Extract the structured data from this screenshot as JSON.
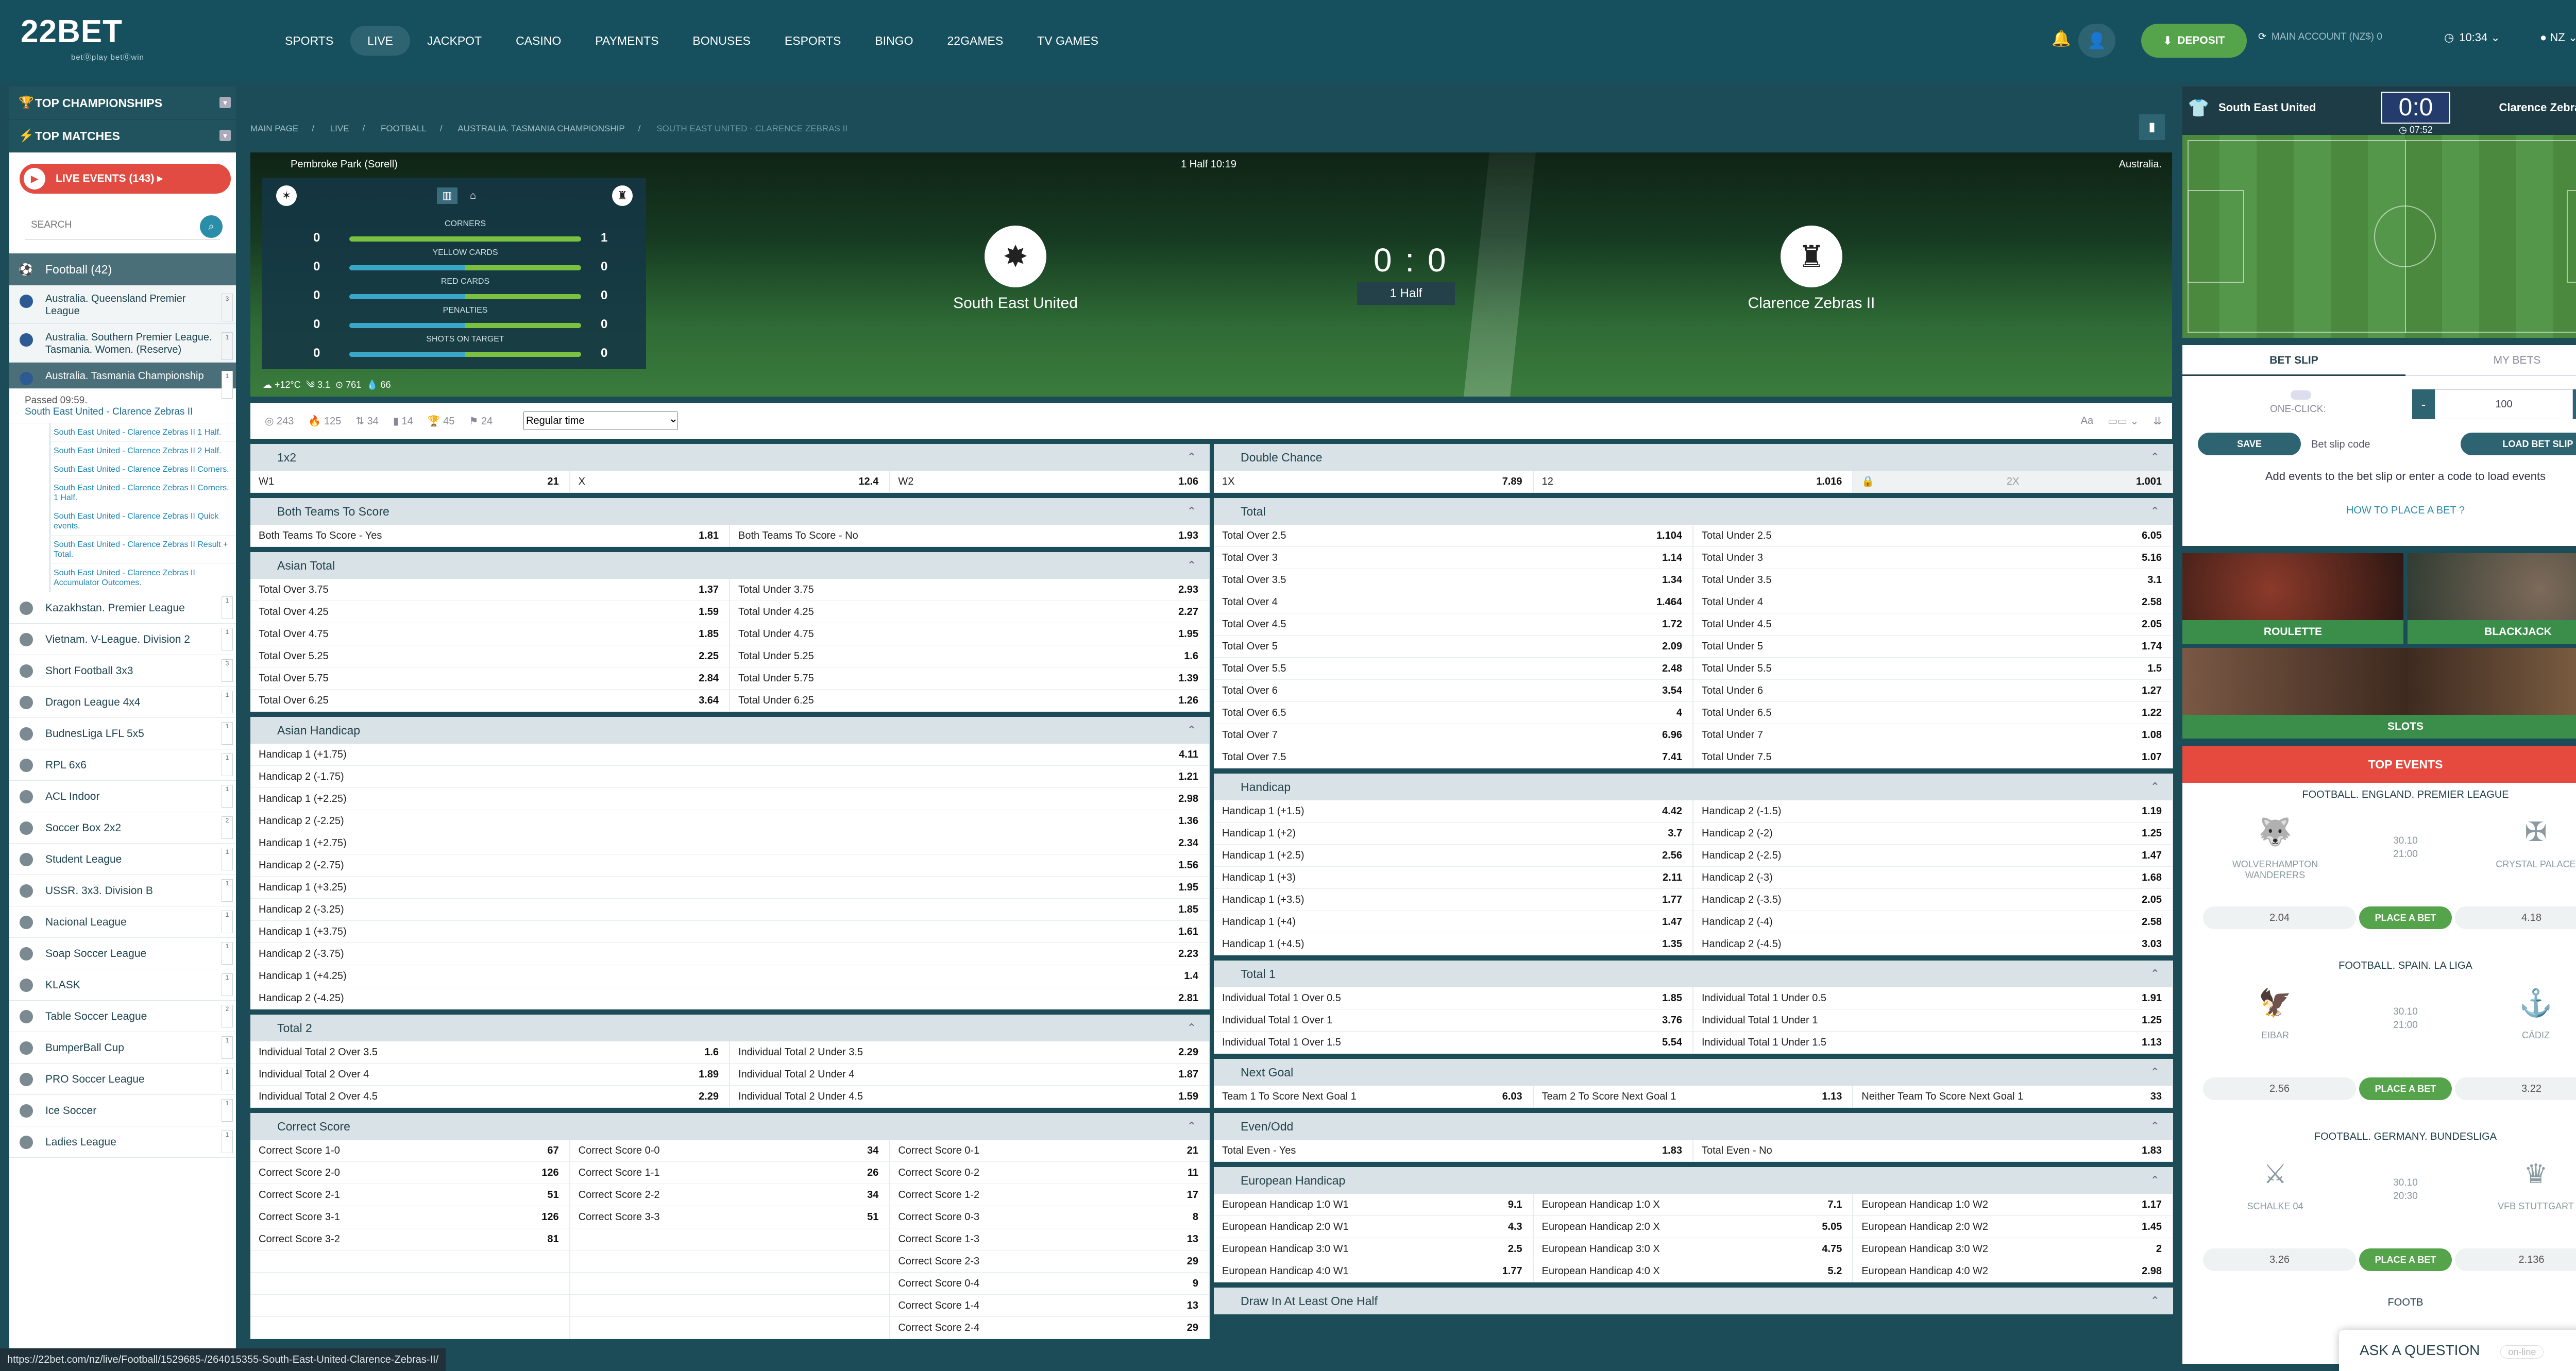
{
  "brand": {
    "logo": "22BET",
    "tagline": "bet⓪play bet⓪win"
  },
  "nav": [
    "SPORTS",
    "LIVE",
    "JACKPOT",
    "CASINO",
    "PAYMENTS",
    "BONUSES",
    "ESPORTS",
    "BINGO",
    "22GAMES",
    "TV GAMES"
  ],
  "header": {
    "deposit": "DEPOSIT",
    "account": "MAIN ACCOUNT (NZ$) 0",
    "time": "10:34",
    "lang": "NZ"
  },
  "sidebar": {
    "top_championships": "TOP CHAMPIONSHIPS",
    "top_matches": "TOP MATCHES",
    "live_events": "LIVE EVENTS (143)",
    "search_placeholder": "SEARCH",
    "sport": "Football (42)",
    "leagues_top": [
      {
        "name": "Australia. Queensland Premier League",
        "count": "3"
      },
      {
        "name": "Australia. Southern Premier League. Tasmania. Women. (Reserve)",
        "count": "1"
      },
      {
        "name": "Australia. Tasmania Championship",
        "count": "1"
      }
    ],
    "match": {
      "passed": "Passed 09:59.",
      "title": "South East United - Clarence Zebras II"
    },
    "sub_events": [
      "South East United - Clarence Zebras II 1 Half.",
      "South East United - Clarence Zebras II 2 Half.",
      "South East United - Clarence Zebras II Corners.",
      "South East United - Clarence Zebras II Corners. 1 Half.",
      "South East United - Clarence Zebras II Quick events.",
      "South East United - Clarence Zebras II Result + Total.",
      "South East United - Clarence Zebras II Accumulator Outcomes."
    ],
    "leagues": [
      {
        "name": "Kazakhstan. Premier League",
        "count": "1"
      },
      {
        "name": "Vietnam. V-League. Division 2",
        "count": "1"
      },
      {
        "name": "Short Football 3x3",
        "count": "3"
      },
      {
        "name": "Dragon League 4x4",
        "count": "1"
      },
      {
        "name": "BudnesLiga LFL 5x5",
        "count": "1"
      },
      {
        "name": "RPL 6x6",
        "count": "1"
      },
      {
        "name": "ACL Indoor",
        "count": "1"
      },
      {
        "name": "Soccer Box 2x2",
        "count": "2"
      },
      {
        "name": "Student League",
        "count": "1"
      },
      {
        "name": "USSR. 3x3. Division B",
        "count": "1"
      },
      {
        "name": "Nacional League",
        "count": "1"
      },
      {
        "name": "Soap Soccer League",
        "count": "1"
      },
      {
        "name": "KLASK",
        "count": "1"
      },
      {
        "name": "Table Soccer League",
        "count": "2"
      },
      {
        "name": "BumperBall Cup",
        "count": "1"
      },
      {
        "name": "PRO Soccer League",
        "count": "1"
      },
      {
        "name": "Ice Soccer",
        "count": "1"
      },
      {
        "name": "Ladies League",
        "count": "1"
      }
    ]
  },
  "breadcrumbs": [
    "MAIN PAGE",
    "LIVE",
    "FOOTBALL",
    "AUSTRALIA. TASMANIA CHAMPIONSHIP",
    "SOUTH EAST UNITED - CLARENCE ZEBRAS II"
  ],
  "match": {
    "venue": "Pembroke Park (Sorell)",
    "period": "1 Half 10:19",
    "country": "Australia.",
    "home": "South East United",
    "away": "Clarence Zebras II",
    "score": "0 : 0",
    "half": "1 Half",
    "stats": [
      {
        "label": "CORNERS",
        "home": "0",
        "away": "1",
        "home_share": 0
      },
      {
        "label": "YELLOW CARDS",
        "home": "0",
        "away": "0",
        "home_share": 0.5
      },
      {
        "label": "RED CARDS",
        "home": "0",
        "away": "0",
        "home_share": 0.5
      },
      {
        "label": "PENALTIES",
        "home": "0",
        "away": "0",
        "home_share": 0.5
      },
      {
        "label": "SHOTS ON TARGET",
        "home": "0",
        "away": "0",
        "home_share": 0.5
      }
    ],
    "weather": {
      "temp": "+12°C",
      "wind": "3.1",
      "pressure": "761",
      "humidity": "66"
    }
  },
  "filters": {
    "counts": [
      "243",
      "125",
      "34",
      "14",
      "45",
      "24"
    ],
    "period": "Regular time"
  },
  "markets_left": [
    {
      "title": "1x2",
      "rows": [
        [
          [
            "W1",
            "21"
          ],
          [
            "X",
            "12.4"
          ],
          [
            "W2",
            "1.06"
          ]
        ]
      ]
    },
    {
      "title": "Both Teams To Score",
      "rows": [
        [
          [
            "Both Teams To Score - Yes",
            "1.81"
          ],
          [
            "Both Teams To Score - No",
            "1.93"
          ]
        ]
      ]
    },
    {
      "title": "Asian Total",
      "rows": [
        [
          [
            "Total Over 3.75",
            "1.37"
          ],
          [
            "Total Under 3.75",
            "2.93"
          ]
        ],
        [
          [
            "Total Over 4.25",
            "1.59"
          ],
          [
            "Total Under 4.25",
            "2.27"
          ]
        ],
        [
          [
            "Total Over 4.75",
            "1.85"
          ],
          [
            "Total Under 4.75",
            "1.95"
          ]
        ],
        [
          [
            "Total Over 5.25",
            "2.25"
          ],
          [
            "Total Under 5.25",
            "1.6"
          ]
        ],
        [
          [
            "Total Over 5.75",
            "2.84"
          ],
          [
            "Total Under 5.75",
            "1.39"
          ]
        ],
        [
          [
            "Total Over 6.25",
            "3.64"
          ],
          [
            "Total Under 6.25",
            "1.26"
          ]
        ]
      ]
    },
    {
      "title": "Asian Handicap",
      "rows": [
        [
          [
            "Handicap 1 (+1.75)",
            "4.11"
          ]
        ],
        [
          [
            "Handicap 2 (-1.75)",
            "1.21"
          ]
        ],
        [
          [
            "Handicap 1 (+2.25)",
            "2.98"
          ]
        ],
        [
          [
            "Handicap 2 (-2.25)",
            "1.36"
          ]
        ],
        [
          [
            "Handicap 1 (+2.75)",
            "2.34"
          ]
        ],
        [
          [
            "Handicap 2 (-2.75)",
            "1.56"
          ]
        ],
        [
          [
            "Handicap 1 (+3.25)",
            "1.95"
          ]
        ],
        [
          [
            "Handicap 2 (-3.25)",
            "1.85"
          ]
        ],
        [
          [
            "Handicap 1 (+3.75)",
            "1.61"
          ]
        ],
        [
          [
            "Handicap 2 (-3.75)",
            "2.23"
          ]
        ],
        [
          [
            "Handicap 1 (+4.25)",
            "1.4"
          ]
        ],
        [
          [
            "Handicap 2 (-4.25)",
            "2.81"
          ]
        ]
      ]
    },
    {
      "title": "Total 2",
      "rows": [
        [
          [
            "Individual Total 2 Over 3.5",
            "1.6"
          ],
          [
            "Individual Total 2 Under 3.5",
            "2.29"
          ]
        ],
        [
          [
            "Individual Total 2 Over 4",
            "1.89"
          ],
          [
            "Individual Total 2 Under 4",
            "1.87"
          ]
        ],
        [
          [
            "Individual Total 2 Over 4.5",
            "2.29"
          ],
          [
            "Individual Total 2 Under 4.5",
            "1.59"
          ]
        ]
      ]
    },
    {
      "title": "Correct Score",
      "rows": [
        [
          [
            "Correct Score 1-0",
            "67"
          ],
          [
            "Correct Score 0-0",
            "34"
          ],
          [
            "Correct Score 0-1",
            "21"
          ]
        ],
        [
          [
            "Correct Score 2-0",
            "126"
          ],
          [
            "Correct Score 1-1",
            "26"
          ],
          [
            "Correct Score 0-2",
            "11"
          ]
        ],
        [
          [
            "Correct Score 2-1",
            "51"
          ],
          [
            "Correct Score 2-2",
            "34"
          ],
          [
            "Correct Score 1-2",
            "17"
          ]
        ],
        [
          [
            "Correct Score 3-1",
            "126"
          ],
          [
            "Correct Score 3-3",
            "51"
          ],
          [
            "Correct Score 0-3",
            "8"
          ]
        ],
        [
          [
            "Correct Score 3-2",
            "81"
          ],
          [
            "",
            ""
          ],
          [
            "Correct Score 1-3",
            "13"
          ]
        ],
        [
          [
            "",
            ""
          ],
          [
            "",
            ""
          ],
          [
            "Correct Score 2-3",
            "29"
          ]
        ],
        [
          [
            "",
            ""
          ],
          [
            "",
            ""
          ],
          [
            "Correct Score 0-4",
            "9"
          ]
        ],
        [
          [
            "",
            ""
          ],
          [
            "",
            ""
          ],
          [
            "Correct Score 1-4",
            "13"
          ]
        ],
        [
          [
            "",
            ""
          ],
          [
            "",
            ""
          ],
          [
            "Correct Score 2-4",
            "29"
          ]
        ]
      ]
    }
  ],
  "markets_right": [
    {
      "title": "Double Chance",
      "rows": [
        [
          [
            "1X",
            "7.89"
          ],
          [
            "12",
            "1.016"
          ],
          [
            "2X",
            "1.001"
          ]
        ]
      ]
    },
    {
      "title": "Total",
      "rows": [
        [
          [
            "Total Over 2.5",
            "1.104"
          ],
          [
            "Total Under 2.5",
            "6.05"
          ]
        ],
        [
          [
            "Total Over 3",
            "1.14"
          ],
          [
            "Total Under 3",
            "5.16"
          ]
        ],
        [
          [
            "Total Over 3.5",
            "1.34"
          ],
          [
            "Total Under 3.5",
            "3.1"
          ]
        ],
        [
          [
            "Total Over 4",
            "1.464"
          ],
          [
            "Total Under 4",
            "2.58"
          ]
        ],
        [
          [
            "Total Over 4.5",
            "1.72"
          ],
          [
            "Total Under 4.5",
            "2.05"
          ]
        ],
        [
          [
            "Total Over 5",
            "2.09"
          ],
          [
            "Total Under 5",
            "1.74"
          ]
        ],
        [
          [
            "Total Over 5.5",
            "2.48"
          ],
          [
            "Total Under 5.5",
            "1.5"
          ]
        ],
        [
          [
            "Total Over 6",
            "3.54"
          ],
          [
            "Total Under 6",
            "1.27"
          ]
        ],
        [
          [
            "Total Over 6.5",
            "4"
          ],
          [
            "Total Under 6.5",
            "1.22"
          ]
        ],
        [
          [
            "Total Over 7",
            "6.96"
          ],
          [
            "Total Under 7",
            "1.08"
          ]
        ],
        [
          [
            "Total Over 7.5",
            "7.41"
          ],
          [
            "Total Under 7.5",
            "1.07"
          ]
        ]
      ]
    },
    {
      "title": "Handicap",
      "rows": [
        [
          [
            "Handicap 1 (+1.5)",
            "4.42"
          ],
          [
            "Handicap 2 (-1.5)",
            "1.19"
          ]
        ],
        [
          [
            "Handicap 1 (+2)",
            "3.7"
          ],
          [
            "Handicap 2 (-2)",
            "1.25"
          ]
        ],
        [
          [
            "Handicap 1 (+2.5)",
            "2.56"
          ],
          [
            "Handicap 2 (-2.5)",
            "1.47"
          ]
        ],
        [
          [
            "Handicap 1 (+3)",
            "2.11"
          ],
          [
            "Handicap 2 (-3)",
            "1.68"
          ]
        ],
        [
          [
            "Handicap 1 (+3.5)",
            "1.77"
          ],
          [
            "Handicap 2 (-3.5)",
            "2.05"
          ]
        ],
        [
          [
            "Handicap 1 (+4)",
            "1.47"
          ],
          [
            "Handicap 2 (-4)",
            "2.58"
          ]
        ],
        [
          [
            "Handicap 1 (+4.5)",
            "1.35"
          ],
          [
            "Handicap 2 (-4.5)",
            "3.03"
          ]
        ]
      ]
    },
    {
      "title": "Total 1",
      "rows": [
        [
          [
            "Individual Total 1 Over 0.5",
            "1.85"
          ],
          [
            "Individual Total 1 Under 0.5",
            "1.91"
          ]
        ],
        [
          [
            "Individual Total 1 Over 1",
            "3.76"
          ],
          [
            "Individual Total 1 Under 1",
            "1.25"
          ]
        ],
        [
          [
            "Individual Total 1 Over 1.5",
            "5.54"
          ],
          [
            "Individual Total 1 Under 1.5",
            "1.13"
          ]
        ]
      ]
    },
    {
      "title": "Next Goal",
      "rows": [
        [
          [
            "Team 1 To Score Next Goal 1",
            "6.03"
          ],
          [
            "Team 2 To Score Next Goal 1",
            "1.13"
          ],
          [
            "Neither Team To Score Next Goal 1",
            "33"
          ]
        ]
      ]
    },
    {
      "title": "Even/Odd",
      "rows": [
        [
          [
            "Total Even - Yes",
            "1.83"
          ],
          [
            "Total Even - No",
            "1.83"
          ]
        ]
      ]
    },
    {
      "title": "European Handicap",
      "rows": [
        [
          [
            "European Handicap 1:0 W1",
            "9.1"
          ],
          [
            "European Handicap 1:0 X",
            "7.1"
          ],
          [
            "European Handicap 1:0 W2",
            "1.17"
          ]
        ],
        [
          [
            "European Handicap 2:0 W1",
            "4.3"
          ],
          [
            "European Handicap 2:0 X",
            "5.05"
          ],
          [
            "European Handicap 2:0 W2",
            "1.45"
          ]
        ],
        [
          [
            "European Handicap 3:0 W1",
            "2.5"
          ],
          [
            "European Handicap 3:0 X",
            "4.75"
          ],
          [
            "European Handicap 3:0 W2",
            "2"
          ]
        ],
        [
          [
            "European Handicap 4:0 W1",
            "1.77"
          ],
          [
            "European Handicap 4:0 X",
            "5.2"
          ],
          [
            "European Handicap 4:0 W2",
            "2.98"
          ]
        ]
      ]
    },
    {
      "title": "Draw In At Least One Half",
      "rows": []
    }
  ],
  "scoreboard": {
    "home": "South East United",
    "away": "Clarence Zebras II",
    "score": "0:0",
    "clock": "07:52"
  },
  "betslip": {
    "tab1": "BET SLIP",
    "tab2": "MY BETS",
    "one_click": "ONE-CLICK:",
    "stake": "100",
    "save": "SAVE",
    "code_label": "Bet slip code",
    "load": "LOAD BET SLIP",
    "hint": "Add events to the bet slip or enter a code to load events",
    "howto": "HOW TO PLACE A BET"
  },
  "casino": {
    "roulette": "ROULETTE",
    "blackjack": "BLACKJACK",
    "slots": "SLOTS"
  },
  "top_events": {
    "title": "TOP EVENTS",
    "place": "PLACE A BET",
    "items": [
      {
        "league": "FOOTBALL. ENGLAND. PREMIER LEAGUE",
        "home": "WOLVERHAMPTON WANDERERS",
        "away": "CRYSTAL PALACE",
        "date": "30.10",
        "time": "21:00",
        "o1": "2.04",
        "o2": "4.18"
      },
      {
        "league": "FOOTBALL. SPAIN. LA LIGA",
        "home": "EIBAR",
        "away": "CÁDIZ",
        "date": "30.10",
        "time": "21:00",
        "o1": "2.56",
        "o2": "3.22"
      },
      {
        "league": "FOOTBALL. GERMANY. BUNDESLIGA",
        "home": "SCHALKE 04",
        "away": "VFB STUTTGART",
        "date": "30.10",
        "time": "20:30",
        "o1": "3.26",
        "o2": "2.136"
      }
    ],
    "more": "FOOTB"
  },
  "status_url": "https://22bet.com/nz/live/Football/1529685-/264015355-South-East-United-Clarence-Zebras-II/",
  "chat": {
    "label": "ASK A QUESTION",
    "status": "on-line"
  }
}
